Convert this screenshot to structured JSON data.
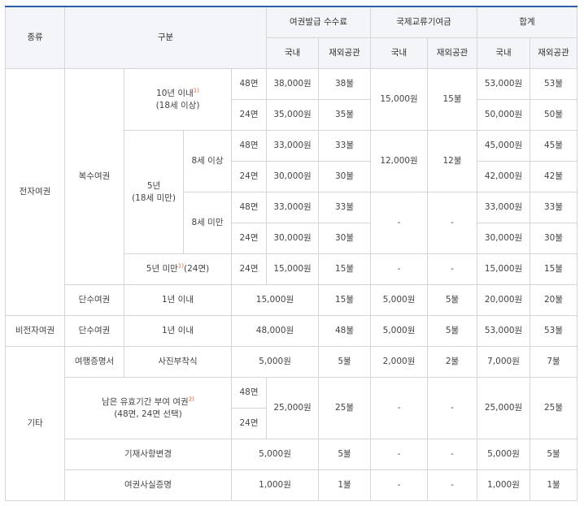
{
  "header": {
    "type": "종류",
    "category": "구분",
    "fee": "여권발급 수수료",
    "intl": "국제교류기여금",
    "total": "합계",
    "domestic": "국내",
    "overseas": "재외공관"
  },
  "pages": {
    "p48": "48면",
    "p24": "24면"
  },
  "groups": {
    "electronic": "전자여권",
    "multiple": "복수여권",
    "single": "단수여권",
    "nonelectronic": "비전자여권",
    "etc": "기타"
  },
  "periods": {
    "ten_years_line1": "10년 이내",
    "ten_years_line2": "(18세 이상)",
    "five_years_line1": "5년",
    "five_years_line2": "(18세 미만)",
    "age8_over": "8세 이상",
    "age8_under": "8세 미만",
    "under5_prefix": "5년 미만",
    "under5_suffix": " (24면)",
    "one_year": "1년 이내"
  },
  "notes": {
    "n1": "1)",
    "n2": "2)"
  },
  "etc_items": {
    "travel_cert": "여행증명서",
    "photo": "사진부착식",
    "remaining_line1": "남은 유효기간 부여 여권",
    "remaining_line2": "(48면, 24면 선택)",
    "amendment": "기재사항변경",
    "fact_cert": "여권사실증명"
  },
  "dash": "-",
  "values": {
    "r1": {
      "fd": "38,000원",
      "fo": "38불",
      "id": "15,000원",
      "io": "15불",
      "td": "53,000원",
      "to": "53불"
    },
    "r2": {
      "fd": "35,000원",
      "fo": "35불",
      "td": "50,000원",
      "to": "50불"
    },
    "r3": {
      "fd": "33,000원",
      "fo": "33불",
      "id": "12,000원",
      "io": "12불",
      "td": "45,000원",
      "to": "45불"
    },
    "r4": {
      "fd": "30,000원",
      "fo": "30불",
      "td": "42,000원",
      "to": "42불"
    },
    "r5": {
      "fd": "33,000원",
      "fo": "33불",
      "td": "33,000원",
      "to": "33불"
    },
    "r6": {
      "fd": "30,000원",
      "fo": "30불",
      "td": "30,000원",
      "to": "30불"
    },
    "r7": {
      "fd": "15,000원",
      "fo": "15불",
      "td": "15,000원",
      "to": "15불"
    },
    "r8": {
      "fd": "15,000원",
      "fo": "15불",
      "id": "5,000원",
      "io": "5불",
      "td": "20,000원",
      "to": "20불"
    },
    "r9": {
      "fd": "48,000원",
      "fo": "48불",
      "id": "5,000원",
      "io": "5불",
      "td": "53,000원",
      "to": "53불"
    },
    "r10": {
      "fd": "5,000원",
      "fo": "5불",
      "id": "2,000원",
      "io": "2불",
      "td": "7,000원",
      "to": "7불"
    },
    "r11": {
      "fd": "25,000원",
      "fo": "25불",
      "td": "25,000원",
      "to": "25불"
    },
    "r12": {
      "fd": "5,000원",
      "fo": "5불",
      "td": "5,000원",
      "to": "5불"
    },
    "r13": {
      "fd": "1,000원",
      "fo": "1불",
      "td": "1,000원",
      "to": "1불"
    }
  }
}
